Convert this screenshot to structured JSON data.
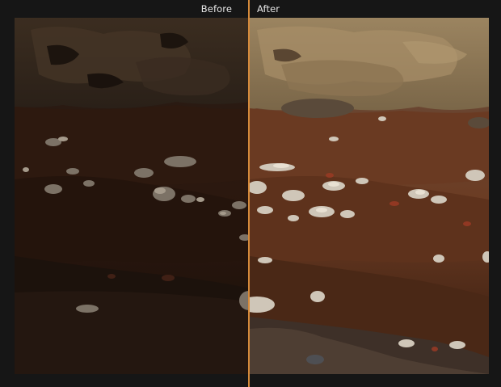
{
  "compare": {
    "before_label": "Before",
    "after_label": "After",
    "image_subject": "rock-and-soil-strata-photo",
    "colors": {
      "divider": "#d58a3b",
      "background": "#161616",
      "label": "#e6e6e6"
    }
  }
}
